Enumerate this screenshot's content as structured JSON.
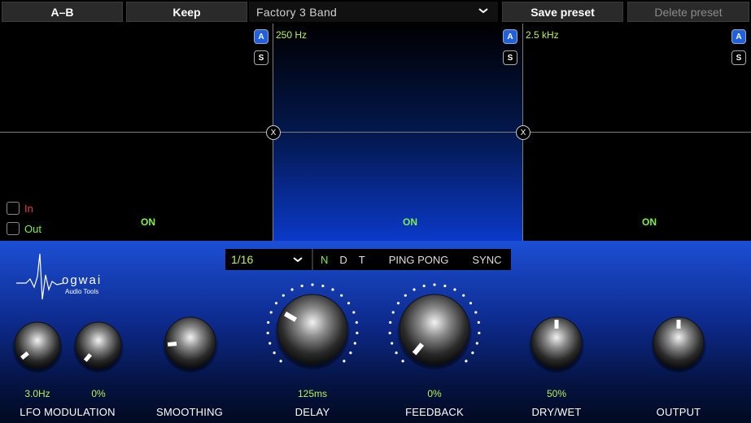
{
  "toolbar": {
    "ab_label": "A–B",
    "keep_label": "Keep",
    "preset_name": "Factory 3 Band",
    "save_label": "Save preset",
    "delete_label": "Delete preset"
  },
  "bands": {
    "split_low": "250 Hz",
    "split_high": "2.5 kHz",
    "low_state": "ON",
    "mid_state": "ON",
    "high_state": "ON",
    "a_label": "A",
    "s_label": "S",
    "x_label": "X"
  },
  "monitor": {
    "in_label": "In",
    "out_label": "Out",
    "in_color": "#e0443a",
    "out_color": "#7df04a"
  },
  "logo": {
    "name": "ogwai",
    "tagline": "Audio Tools"
  },
  "delay_settings": {
    "division": "1/16",
    "modes": [
      "N",
      "D",
      "T"
    ],
    "active_mode": "N",
    "ping_pong_label": "PING PONG",
    "sync_label": "SYNC"
  },
  "knobs": {
    "lfo_rate": {
      "value": "3.0Hz",
      "icon": "knob-icon"
    },
    "lfo_depth": {
      "value": "0%",
      "icon": "knob-icon"
    },
    "lfo_label": "LFO MODULATION",
    "smoothing": {
      "label": "SMOOTHING"
    },
    "delay": {
      "value": "125ms",
      "label": "DELAY"
    },
    "feedback": {
      "value": "0%",
      "label": "FEEDBACK"
    },
    "drywet": {
      "value": "50%",
      "label": "DRY/WET"
    },
    "output": {
      "label": "OUTPUT"
    }
  },
  "colors": {
    "accent_green": "#b9f05a",
    "band_active_blue": "#0b39c9"
  }
}
